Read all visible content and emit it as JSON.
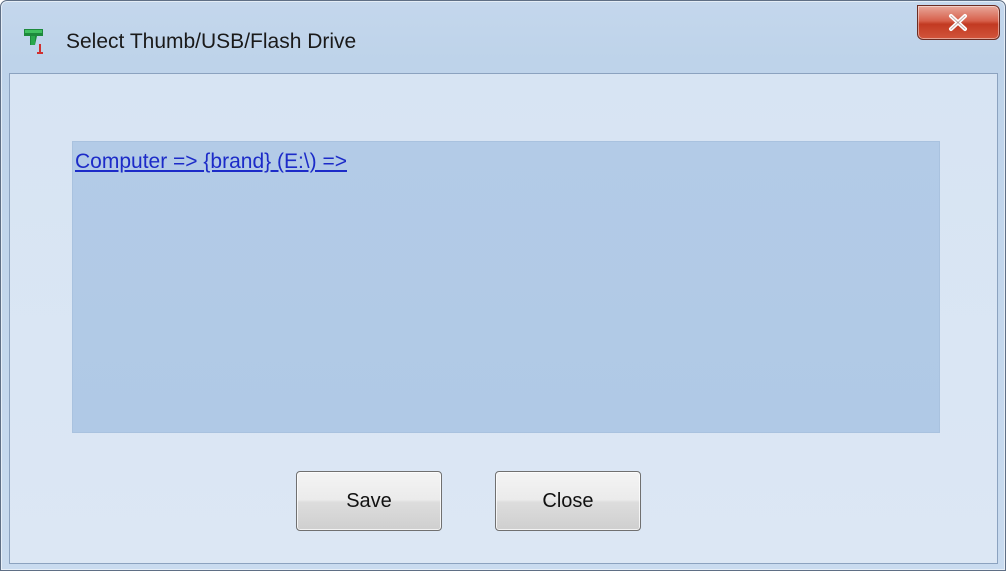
{
  "window": {
    "title": "Select Thumb/USB/Flash Drive",
    "icon": "thumb-drive-app-icon",
    "close_icon": "close-icon",
    "accent_close": "#c8432a"
  },
  "path": {
    "link_text": "Computer => {brand} (E:\\) =>"
  },
  "buttons": {
    "save_label": "Save",
    "close_label": "Close"
  },
  "colors": {
    "panel": "#b2cae6",
    "link": "#1c2bc8",
    "window_frame": "#c4d7ec"
  }
}
